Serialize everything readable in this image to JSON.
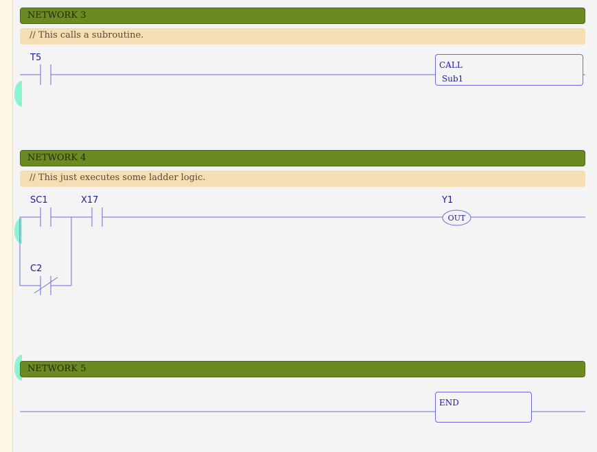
{
  "networks": [
    {
      "title": "NETWORK 3",
      "comment": "// This calls a subroutine.",
      "contact": "T5",
      "box_line1": "CALL",
      "box_line2": "Sub1"
    },
    {
      "title": "NETWORK 4",
      "comment": "// This just executes some ladder logic.",
      "contact1": "SC1",
      "contact2": "X17",
      "contact3": "C2",
      "coil": "Y1",
      "coil_type": "OUT"
    },
    {
      "title": "NETWORK 5",
      "box_line1": "END"
    }
  ],
  "colors": {
    "header": "#6b8a22",
    "comment_bg": "#f5deb3",
    "wire": "#6a6ae0",
    "label": "#1a1aa0",
    "marker": "#8ef4cf"
  },
  "icons": [
    "no-contact-icon",
    "nc-contact-icon",
    "out-coil-icon",
    "call-box",
    "end-box"
  ]
}
